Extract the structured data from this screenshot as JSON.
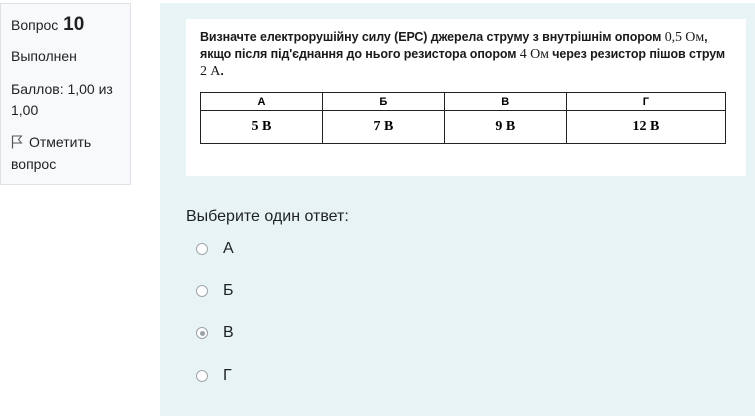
{
  "info": {
    "question_label": "Вопрос",
    "question_number": "10",
    "state": "Выполнен",
    "grade": "Баллов: 1,00 из 1,00",
    "flag_label": "Отметить вопрос"
  },
  "question": {
    "text": "Визначте електрорушійну силу (ЕРС) джерела струму з внутрішнім опором",
    "val1": "0,5 Ом",
    "text2": ", якщо після під'єднання до нього резистора опором",
    "val2": "4 Ом",
    "text3": "через резистор пішов струм",
    "val3": "2 А",
    "text4": ".",
    "table": {
      "headers": [
        "А",
        "Б",
        "В",
        "Г"
      ],
      "values": [
        "5 В",
        "7 В",
        "9 В",
        "12 В"
      ]
    }
  },
  "prompt": "Выберите один ответ:",
  "answers": [
    {
      "label": "А",
      "checked": false
    },
    {
      "label": "Б",
      "checked": false
    },
    {
      "label": "В",
      "checked": true
    },
    {
      "label": "Г",
      "checked": false
    }
  ]
}
